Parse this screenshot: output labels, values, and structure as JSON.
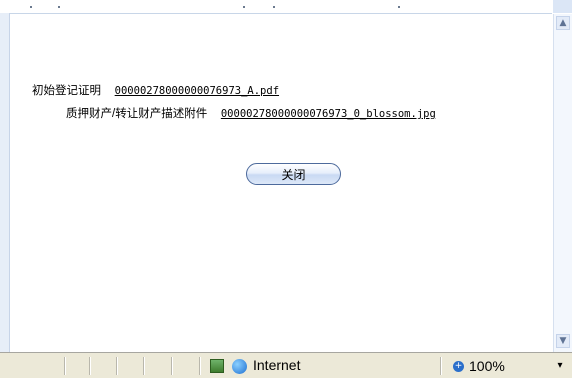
{
  "content": {
    "row1": {
      "label": "初始登记证明",
      "link": "00000278000000076973_A.pdf"
    },
    "row2": {
      "label": "质押财产/转让财产描述附件",
      "link": "00000278000000076973_0_blossom.jpg"
    },
    "close_button": "关闭"
  },
  "statusbar": {
    "zone": "Internet",
    "zoom": "100%",
    "zoom_icon": "zoom-icon",
    "dropdown_icon": "chevron-down-icon"
  },
  "scrollbar": {
    "up": "▲",
    "down": "▼"
  },
  "colors": {
    "button_border": "#4d6a9c",
    "statusbar_bg": "#ece9d8"
  }
}
